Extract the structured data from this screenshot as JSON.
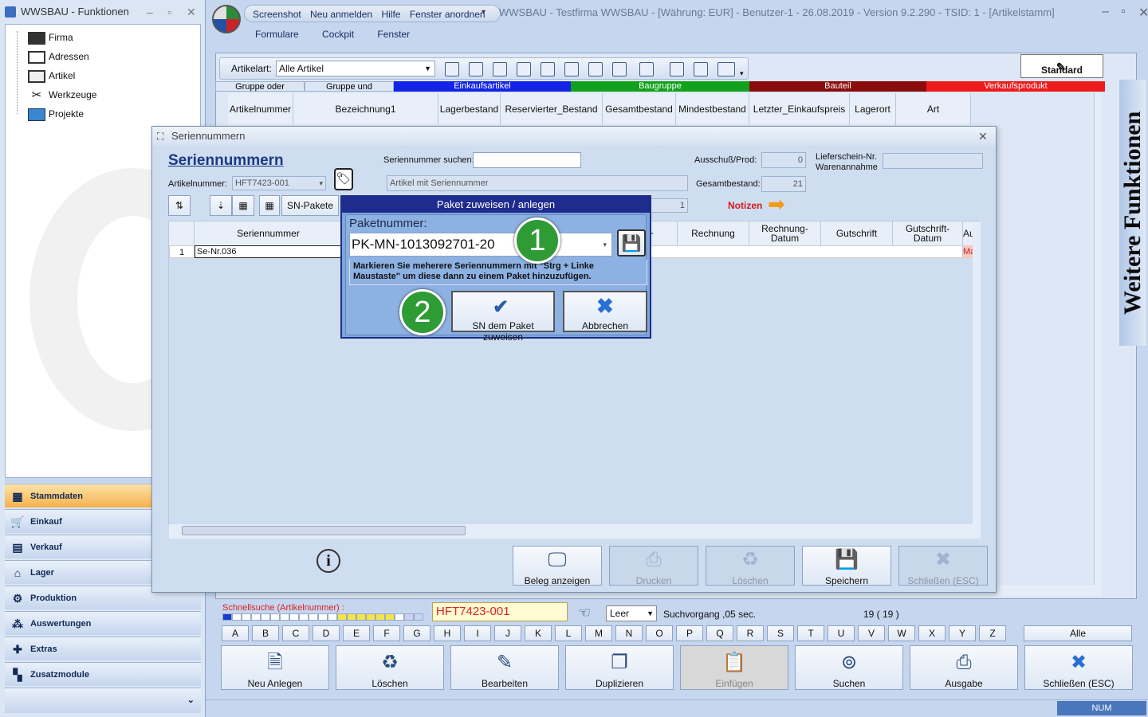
{
  "left": {
    "title": "WWSBAU - Funktionen",
    "tree": [
      {
        "label": "Firma",
        "icon": "factory-icon"
      },
      {
        "label": "Adressen",
        "icon": "addressbook-icon"
      },
      {
        "label": "Artikel",
        "icon": "box-icon"
      },
      {
        "label": "Werkzeuge",
        "icon": "tools-icon"
      },
      {
        "label": "Projekte",
        "icon": "project-icon"
      }
    ],
    "nav": [
      {
        "label": "Stammdaten",
        "active": true
      },
      {
        "label": "Einkauf"
      },
      {
        "label": "Verkauf"
      },
      {
        "label": "Lager"
      },
      {
        "label": "Produktion"
      },
      {
        "label": "Auswertungen"
      },
      {
        "label": "Extras"
      },
      {
        "label": "Zusatzmodule"
      }
    ]
  },
  "main": {
    "title": "WWSBAU - Testfirma WWSBAU - [Währung: EUR] - Benutzer-1 - 26.08.2019 - Version 9.2.290 - TSID: 1  - [Artikelstamm]",
    "qat": [
      "Screenshot",
      "Neu anmelden",
      "Hilfe",
      "Fenster anordnen"
    ],
    "menu": [
      "Formulare",
      "Cockpit",
      "Fenster"
    ],
    "artikelart_label": "Artikelart:",
    "artikelart_value": "Alle Artikel",
    "standard_label": "Standard",
    "categories": [
      {
        "label": "Gruppe oder",
        "color": "#dce6f4",
        "text": "#000"
      },
      {
        "label": "Gruppe und",
        "color": "#dce6f4",
        "text": "#000"
      },
      {
        "label": "Einkaufsartikel",
        "color": "#1424e6",
        "text": "#fff"
      },
      {
        "label": "Baugruppe",
        "color": "#12a11c",
        "text": "#fff"
      },
      {
        "label": "Bauteil",
        "color": "#8a0c0c",
        "text": "#fff"
      },
      {
        "label": "Verkaufsprodukt",
        "color": "#ee1b1b",
        "text": "#fff"
      }
    ],
    "columns": [
      "Artikelnummer",
      "Bezeichnung1",
      "Lagerbestand",
      "Reservierter_Bestand",
      "Gesamtbestand",
      "Mindestbestand",
      "Letzter_Einkaufspreis",
      "Lagerort",
      "Art"
    ],
    "side_panel": "Weitere Funktionen",
    "schnellsuche_label": "Schnellsuche (Artikelnummer) :",
    "search_value": "HFT7423-001",
    "leer_value": "Leer",
    "suchvorgang": "Suchvorgang ,05 sec.",
    "count": "19  ( 19 )",
    "letters": [
      "A",
      "B",
      "C",
      "D",
      "E",
      "F",
      "G",
      "H",
      "I",
      "J",
      "K",
      "L",
      "M",
      "N",
      "O",
      "P",
      "Q",
      "R",
      "S",
      "T",
      "U",
      "V",
      "W",
      "X",
      "Y",
      "Z"
    ],
    "alle_label": "Alle",
    "buttons": [
      {
        "label": "Neu Anlegen",
        "icon": "new-document-icon",
        "enabled": true
      },
      {
        "label": "Löschen",
        "icon": "recycle-bin-icon",
        "enabled": true
      },
      {
        "label": "Bearbeiten",
        "icon": "edit-icon",
        "enabled": true
      },
      {
        "label": "Duplizieren",
        "icon": "duplicate-icon",
        "enabled": true
      },
      {
        "label": "Einfügen",
        "icon": "paste-icon",
        "enabled": false
      },
      {
        "label": "Suchen",
        "icon": "binoculars-icon",
        "enabled": true
      },
      {
        "label": "Ausgabe",
        "icon": "printer-icon",
        "enabled": true
      },
      {
        "label": "Schließen (ESC)",
        "icon": "close-icon",
        "enabled": true
      }
    ],
    "status_num": "NUM"
  },
  "sn": {
    "window_title": "Seriennummern",
    "heading": "Seriennummern",
    "artikelnummer_label": "Artikelnummer:",
    "artikelnummer_value": "HFT7423-001",
    "suchen_label": "Seriennummer suchen:",
    "suchen_value": "",
    "artikel_mit_sn": "Artikel mit Seriennummer",
    "ausschuss_label": "Ausschuß/Prod:",
    "ausschuss_value": "0",
    "gesamtbestand_label": "Gesamtbestand:",
    "gesamtbestand_value": "21",
    "lieferschein_label1": "Lieferschein-Nr.",
    "lieferschein_label2": "Warenannahme",
    "lieferschein_value": "",
    "count_value": "1",
    "notizen_label": "Notizen",
    "sn_pakete_label": "SN-Pakete",
    "columns": [
      "Seriennummer",
      "n-",
      "Rechnung",
      "Rechnung-\nDatum",
      "Gutschrift",
      "Gutschrift-\nDatum",
      "Auft"
    ],
    "rows": [
      {
        "nr": "1",
        "sn": "Se-Nr.036",
        "auft": "Manu"
      }
    ],
    "footer_buttons": [
      {
        "label": "Beleg anzeigen",
        "icon": "monitor-icon",
        "enabled": true
      },
      {
        "label": "Drucken",
        "icon": "printer-icon",
        "enabled": false
      },
      {
        "label": "Löschen",
        "icon": "recycle-bin-icon",
        "enabled": false
      },
      {
        "label": "Speichern",
        "icon": "save-icon",
        "enabled": true
      },
      {
        "label": "Schließen (ESC)",
        "icon": "close-icon",
        "enabled": false
      }
    ]
  },
  "paket": {
    "title": "Paket zuweisen / anlegen",
    "nummer_label": "Paketnummer:",
    "nummer_value": "PK-MN-1013092701-20",
    "hint": "Markieren Sie meherere Seriennummern mit \"Strg + Linke Maustaste\" um diese dann zu einem Paket hinzuzufügen.",
    "assign_label": "SN dem Paket zuweisen",
    "cancel_label": "Abbrechen",
    "marker1": "1",
    "marker2": "2"
  }
}
